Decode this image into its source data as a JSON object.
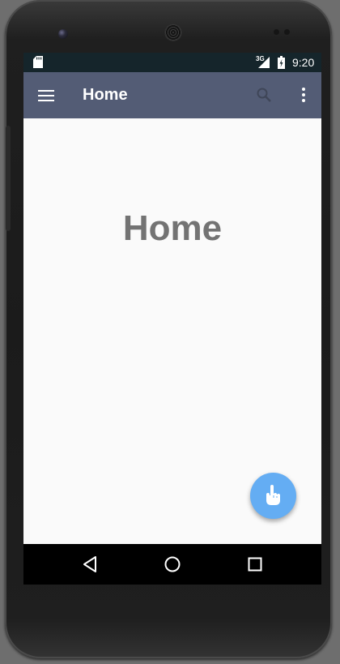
{
  "status_bar": {
    "time": "9:20",
    "network": "3G",
    "icons": [
      "sd-card-icon",
      "signal-icon",
      "battery-charging-icon"
    ]
  },
  "app_bar": {
    "title": "Home",
    "background_color": "#535c75",
    "icons": [
      "menu-icon",
      "search-icon",
      "more-vert-icon"
    ]
  },
  "content": {
    "heading": "Home"
  },
  "fab": {
    "icon": "hand-pointer-icon",
    "color": "#64adf3"
  },
  "nav_bar": {
    "icons": [
      "back-icon",
      "home-icon",
      "recents-icon"
    ]
  }
}
